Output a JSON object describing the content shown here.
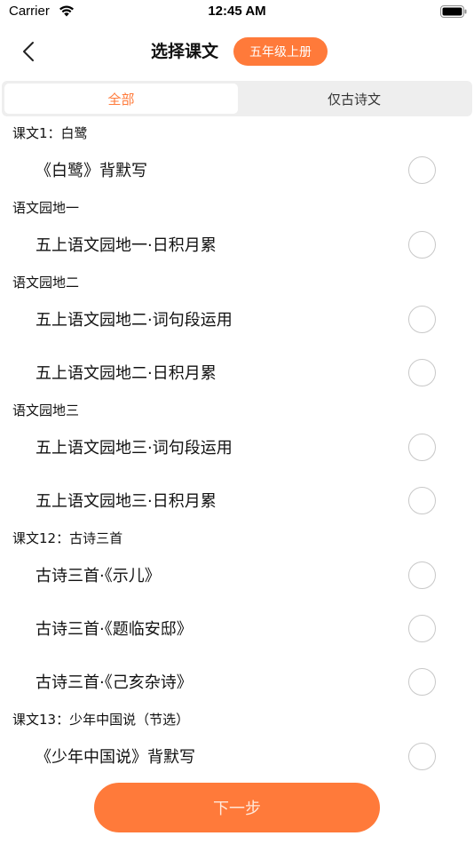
{
  "status_bar": {
    "carrier": "Carrier",
    "time": "12:45 AM"
  },
  "nav": {
    "title": "选择课文",
    "grade": "五年级上册"
  },
  "tabs": [
    {
      "label": "全部",
      "active": true
    },
    {
      "label": "仅古诗文",
      "active": false
    }
  ],
  "sections": [
    {
      "header": "课文1：白鹭",
      "items": [
        {
          "label": "《白鹭》背默写"
        }
      ]
    },
    {
      "header": "语文园地一",
      "items": [
        {
          "label": "五上语文园地一·日积月累"
        }
      ]
    },
    {
      "header": "语文园地二",
      "items": [
        {
          "label": "五上语文园地二·词句段运用"
        },
        {
          "label": "五上语文园地二·日积月累"
        }
      ]
    },
    {
      "header": "语文园地三",
      "items": [
        {
          "label": "五上语文园地三·词句段运用"
        },
        {
          "label": "五上语文园地三·日积月累"
        }
      ]
    },
    {
      "header": "课文12：古诗三首",
      "items": [
        {
          "label": "古诗三首·《示儿》"
        },
        {
          "label": "古诗三首·《题临安邸》"
        },
        {
          "label": "古诗三首·《己亥杂诗》"
        }
      ]
    },
    {
      "header": "课文13：少年中国说（节选）",
      "items": [
        {
          "label": "《少年中国说》背默写"
        }
      ]
    }
  ],
  "next_button": "下一步",
  "colors": {
    "accent": "#ff7a3a",
    "radio_border": "#c8c8c8",
    "segment_bg": "#eeeeee"
  }
}
